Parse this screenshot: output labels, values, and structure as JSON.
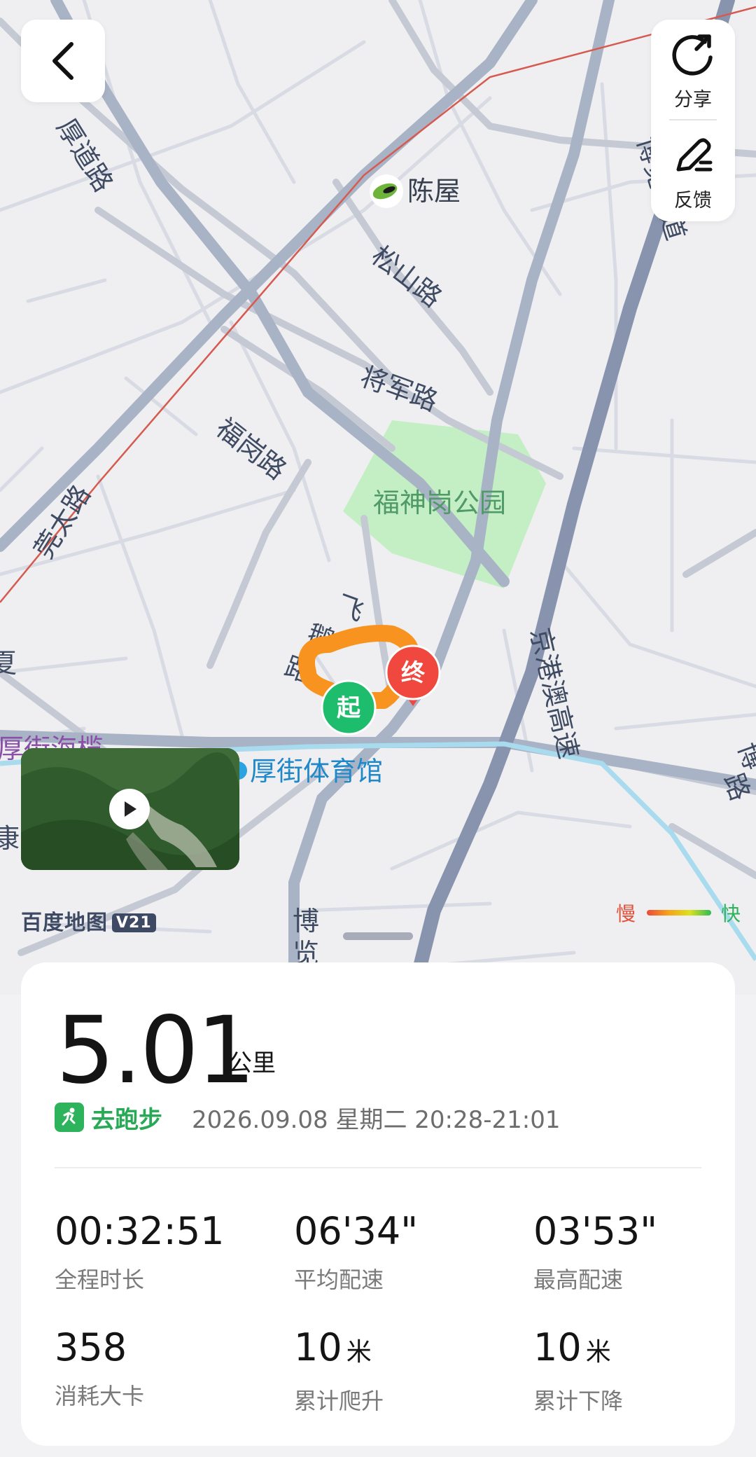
{
  "map": {
    "road_labels": [
      "厚道路",
      "陈屋",
      "松山路",
      "博览大道",
      "将军路",
      "福岗路",
      "莞太路",
      "福神岗公园",
      "飞",
      "鹅",
      "路",
      "京港澳高速",
      "厚街体育馆",
      "博",
      "览",
      "厚街海榄",
      "博",
      "路",
      "夏",
      "康"
    ],
    "start_marker": "起",
    "end_marker": "终",
    "provider": "百度地图",
    "provider_version": "V21",
    "legend": {
      "slow": "慢",
      "fast": "快"
    }
  },
  "toolbar": {
    "back_icon": "back-chevron-icon",
    "share_label": "分享",
    "feedback_label": "反馈"
  },
  "summary": {
    "distance": "5.01",
    "distance_unit": "公里",
    "activity_type": "去跑步",
    "datetime": "2026.09.08 星期二 20:28-21:01"
  },
  "stats": [
    {
      "value": "00:32:51",
      "unit": "",
      "label": "全程时长"
    },
    {
      "value": "06'34\"",
      "unit": "",
      "label": "平均配速"
    },
    {
      "value": "03'53\"",
      "unit": "",
      "label": "最高配速"
    },
    {
      "value": "358",
      "unit": "",
      "label": "消耗大卡"
    },
    {
      "value": "10",
      "unit": "米",
      "label": "累计爬升"
    },
    {
      "value": "10",
      "unit": "米",
      "label": "累计下降"
    }
  ],
  "colors": {
    "route": "#f7931e",
    "start": "#1ebd6e",
    "end": "#f0473e",
    "accent": "#2db35b",
    "park": "#c4efc4"
  }
}
